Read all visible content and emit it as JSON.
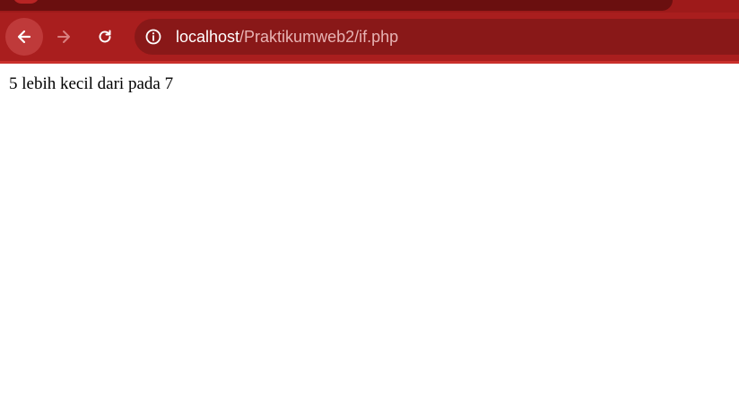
{
  "browser": {
    "address_bar": {
      "host": "localhost",
      "path": "/Praktikumweb2/if.php"
    },
    "icons": {
      "back": "back-arrow-icon",
      "forward": "forward-arrow-icon",
      "reload": "reload-icon",
      "site_info": "info-icon"
    },
    "colors": {
      "chrome": "#a91e1e",
      "omnibox": "#891818",
      "url_host": "#ffffff",
      "url_path": "#e7b3b3"
    }
  },
  "page": {
    "body_text": "5 lebih kecil dari pada 7"
  }
}
